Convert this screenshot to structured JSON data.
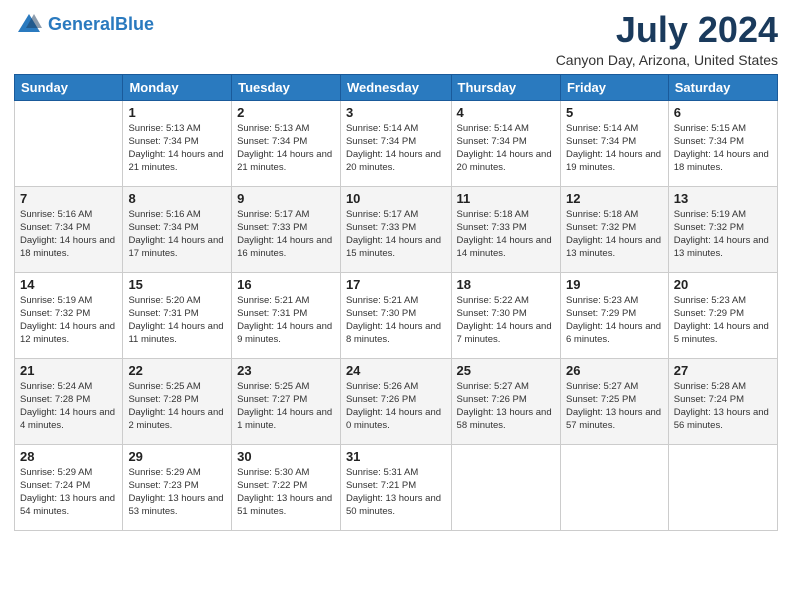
{
  "header": {
    "logo_line1": "General",
    "logo_line2": "Blue",
    "month": "July 2024",
    "location": "Canyon Day, Arizona, United States"
  },
  "weekdays": [
    "Sunday",
    "Monday",
    "Tuesday",
    "Wednesday",
    "Thursday",
    "Friday",
    "Saturday"
  ],
  "weeks": [
    [
      {
        "day": "",
        "sunrise": "",
        "sunset": "",
        "daylight": ""
      },
      {
        "day": "1",
        "sunrise": "Sunrise: 5:13 AM",
        "sunset": "Sunset: 7:34 PM",
        "daylight": "Daylight: 14 hours and 21 minutes."
      },
      {
        "day": "2",
        "sunrise": "Sunrise: 5:13 AM",
        "sunset": "Sunset: 7:34 PM",
        "daylight": "Daylight: 14 hours and 21 minutes."
      },
      {
        "day": "3",
        "sunrise": "Sunrise: 5:14 AM",
        "sunset": "Sunset: 7:34 PM",
        "daylight": "Daylight: 14 hours and 20 minutes."
      },
      {
        "day": "4",
        "sunrise": "Sunrise: 5:14 AM",
        "sunset": "Sunset: 7:34 PM",
        "daylight": "Daylight: 14 hours and 20 minutes."
      },
      {
        "day": "5",
        "sunrise": "Sunrise: 5:14 AM",
        "sunset": "Sunset: 7:34 PM",
        "daylight": "Daylight: 14 hours and 19 minutes."
      },
      {
        "day": "6",
        "sunrise": "Sunrise: 5:15 AM",
        "sunset": "Sunset: 7:34 PM",
        "daylight": "Daylight: 14 hours and 18 minutes."
      }
    ],
    [
      {
        "day": "7",
        "sunrise": "Sunrise: 5:16 AM",
        "sunset": "Sunset: 7:34 PM",
        "daylight": "Daylight: 14 hours and 18 minutes."
      },
      {
        "day": "8",
        "sunrise": "Sunrise: 5:16 AM",
        "sunset": "Sunset: 7:34 PM",
        "daylight": "Daylight: 14 hours and 17 minutes."
      },
      {
        "day": "9",
        "sunrise": "Sunrise: 5:17 AM",
        "sunset": "Sunset: 7:33 PM",
        "daylight": "Daylight: 14 hours and 16 minutes."
      },
      {
        "day": "10",
        "sunrise": "Sunrise: 5:17 AM",
        "sunset": "Sunset: 7:33 PM",
        "daylight": "Daylight: 14 hours and 15 minutes."
      },
      {
        "day": "11",
        "sunrise": "Sunrise: 5:18 AM",
        "sunset": "Sunset: 7:33 PM",
        "daylight": "Daylight: 14 hours and 14 minutes."
      },
      {
        "day": "12",
        "sunrise": "Sunrise: 5:18 AM",
        "sunset": "Sunset: 7:32 PM",
        "daylight": "Daylight: 14 hours and 13 minutes."
      },
      {
        "day": "13",
        "sunrise": "Sunrise: 5:19 AM",
        "sunset": "Sunset: 7:32 PM",
        "daylight": "Daylight: 14 hours and 13 minutes."
      }
    ],
    [
      {
        "day": "14",
        "sunrise": "Sunrise: 5:19 AM",
        "sunset": "Sunset: 7:32 PM",
        "daylight": "Daylight: 14 hours and 12 minutes."
      },
      {
        "day": "15",
        "sunrise": "Sunrise: 5:20 AM",
        "sunset": "Sunset: 7:31 PM",
        "daylight": "Daylight: 14 hours and 11 minutes."
      },
      {
        "day": "16",
        "sunrise": "Sunrise: 5:21 AM",
        "sunset": "Sunset: 7:31 PM",
        "daylight": "Daylight: 14 hours and 9 minutes."
      },
      {
        "day": "17",
        "sunrise": "Sunrise: 5:21 AM",
        "sunset": "Sunset: 7:30 PM",
        "daylight": "Daylight: 14 hours and 8 minutes."
      },
      {
        "day": "18",
        "sunrise": "Sunrise: 5:22 AM",
        "sunset": "Sunset: 7:30 PM",
        "daylight": "Daylight: 14 hours and 7 minutes."
      },
      {
        "day": "19",
        "sunrise": "Sunrise: 5:23 AM",
        "sunset": "Sunset: 7:29 PM",
        "daylight": "Daylight: 14 hours and 6 minutes."
      },
      {
        "day": "20",
        "sunrise": "Sunrise: 5:23 AM",
        "sunset": "Sunset: 7:29 PM",
        "daylight": "Daylight: 14 hours and 5 minutes."
      }
    ],
    [
      {
        "day": "21",
        "sunrise": "Sunrise: 5:24 AM",
        "sunset": "Sunset: 7:28 PM",
        "daylight": "Daylight: 14 hours and 4 minutes."
      },
      {
        "day": "22",
        "sunrise": "Sunrise: 5:25 AM",
        "sunset": "Sunset: 7:28 PM",
        "daylight": "Daylight: 14 hours and 2 minutes."
      },
      {
        "day": "23",
        "sunrise": "Sunrise: 5:25 AM",
        "sunset": "Sunset: 7:27 PM",
        "daylight": "Daylight: 14 hours and 1 minute."
      },
      {
        "day": "24",
        "sunrise": "Sunrise: 5:26 AM",
        "sunset": "Sunset: 7:26 PM",
        "daylight": "Daylight: 14 hours and 0 minutes."
      },
      {
        "day": "25",
        "sunrise": "Sunrise: 5:27 AM",
        "sunset": "Sunset: 7:26 PM",
        "daylight": "Daylight: 13 hours and 58 minutes."
      },
      {
        "day": "26",
        "sunrise": "Sunrise: 5:27 AM",
        "sunset": "Sunset: 7:25 PM",
        "daylight": "Daylight: 13 hours and 57 minutes."
      },
      {
        "day": "27",
        "sunrise": "Sunrise: 5:28 AM",
        "sunset": "Sunset: 7:24 PM",
        "daylight": "Daylight: 13 hours and 56 minutes."
      }
    ],
    [
      {
        "day": "28",
        "sunrise": "Sunrise: 5:29 AM",
        "sunset": "Sunset: 7:24 PM",
        "daylight": "Daylight: 13 hours and 54 minutes."
      },
      {
        "day": "29",
        "sunrise": "Sunrise: 5:29 AM",
        "sunset": "Sunset: 7:23 PM",
        "daylight": "Daylight: 13 hours and 53 minutes."
      },
      {
        "day": "30",
        "sunrise": "Sunrise: 5:30 AM",
        "sunset": "Sunset: 7:22 PM",
        "daylight": "Daylight: 13 hours and 51 minutes."
      },
      {
        "day": "31",
        "sunrise": "Sunrise: 5:31 AM",
        "sunset": "Sunset: 7:21 PM",
        "daylight": "Daylight: 13 hours and 50 minutes."
      },
      {
        "day": "",
        "sunrise": "",
        "sunset": "",
        "daylight": ""
      },
      {
        "day": "",
        "sunrise": "",
        "sunset": "",
        "daylight": ""
      },
      {
        "day": "",
        "sunrise": "",
        "sunset": "",
        "daylight": ""
      }
    ]
  ]
}
